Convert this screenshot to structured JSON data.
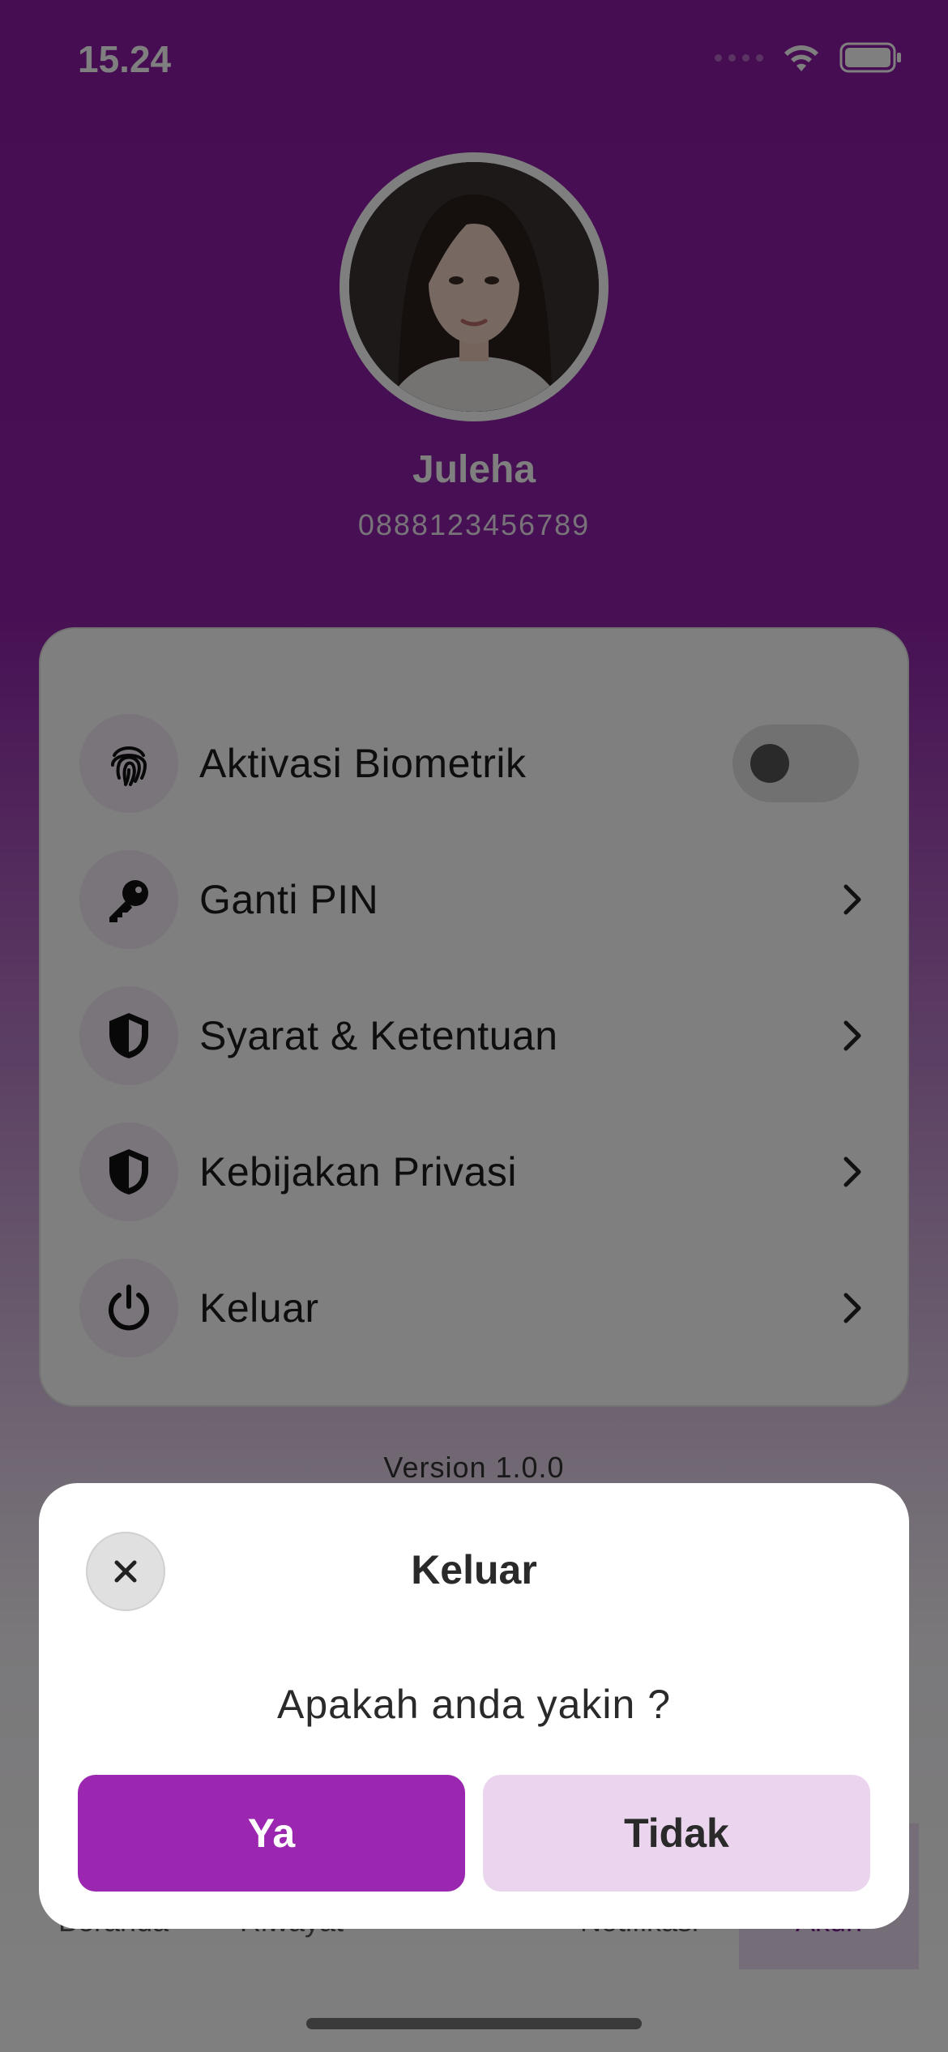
{
  "status_bar": {
    "time": "15.24",
    "icons": [
      "cellular-signal-icon",
      "wifi-icon",
      "battery-icon"
    ]
  },
  "profile": {
    "name": "Juleha",
    "phone": "0888123456789",
    "avatar_icon": "profile-photo"
  },
  "menu": {
    "items": [
      {
        "label": "Aktivasi Biometrik",
        "icon": "fingerprint-icon",
        "control": "toggle",
        "toggle_on": false
      },
      {
        "label": "Ganti PIN",
        "icon": "key-icon",
        "control": "chevron"
      },
      {
        "label": "Syarat & Ketentuan",
        "icon": "shield-icon",
        "control": "chevron"
      },
      {
        "label": "Kebijakan Privasi",
        "icon": "shield-icon",
        "control": "chevron"
      },
      {
        "label": "Keluar",
        "icon": "power-icon",
        "control": "chevron"
      }
    ]
  },
  "version": "Version 1.0.0",
  "bottom_nav": {
    "items": [
      {
        "label": "Beranda"
      },
      {
        "label": "Riwayat"
      },
      {
        "label": "Notifikasi"
      },
      {
        "label": "Akun",
        "active": true
      }
    ]
  },
  "dialog": {
    "title": "Keluar",
    "message": "Apakah anda yakin ?",
    "confirm_label": "Ya",
    "cancel_label": "Tidak",
    "close_icon": "close-icon"
  },
  "colors": {
    "primary": "#9b27b0",
    "secondary": "#ebd5ee",
    "overlay": "rgba(0,0,0,0.5)"
  }
}
